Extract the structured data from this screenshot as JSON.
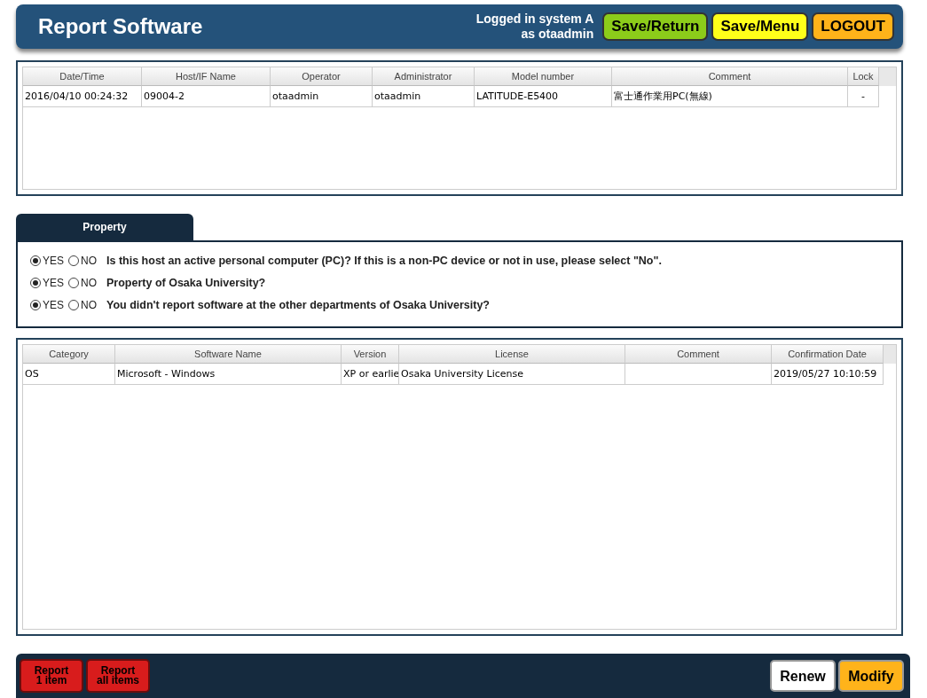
{
  "header": {
    "title": "Report Software",
    "login": "Logged in system A\nas otaadmin",
    "buttons": [
      {
        "label": "Save/Return",
        "kind": "green"
      },
      {
        "label": "Save/Menu",
        "kind": "yellow"
      },
      {
        "label": "LOGOUT",
        "kind": "orange"
      }
    ]
  },
  "hosts": {
    "columns": [
      "Date/Time",
      "Host/IF Name",
      "Operator",
      "Administrator",
      "Model number",
      "Comment",
      "Lock"
    ],
    "rows": [
      {
        "selected": false,
        "cells": [
          "2016/04/10 00:24:32",
          "09004-2",
          "otaadmin",
          "otaadmin",
          "LATITUDE-E5400",
          "富士通作業用PC(無線)",
          "-"
        ]
      }
    ]
  },
  "property": {
    "tab": "Property",
    "questions": [
      {
        "text": "Is this host an active personal computer (PC)? If this is a non-PC device or not in use, please select \"No\".",
        "options": [
          {
            "label": "YES",
            "selected": true
          },
          {
            "label": "NO",
            "selected": false
          }
        ]
      },
      {
        "text": "Property of Osaka University?",
        "options": [
          {
            "label": "YES",
            "selected": true
          },
          {
            "label": "NO",
            "selected": false
          }
        ]
      },
      {
        "text": "You didn't report software at the other departments of Osaka University?",
        "options": [
          {
            "label": "YES",
            "selected": true
          },
          {
            "label": "NO",
            "selected": false
          }
        ]
      }
    ]
  },
  "software": {
    "columns": [
      "Category",
      "Software Name",
      "Version",
      "License",
      "Comment",
      "Confirmation Date"
    ],
    "rows": [
      {
        "selected": false,
        "cells": [
          "OS",
          "Microsoft - Windows",
          "XP or earlie",
          "Osaka University License",
          "",
          "2019/05/27 10:10:59"
        ]
      }
    ]
  },
  "footer": {
    "left_buttons": [
      {
        "label": "Report\n1 item",
        "kind": "red"
      },
      {
        "label": "Report\nall items",
        "kind": "red"
      }
    ],
    "right_buttons": [
      {
        "label": "Renew",
        "kind": "white"
      },
      {
        "label": "Modify",
        "kind": "orange"
      }
    ]
  }
}
